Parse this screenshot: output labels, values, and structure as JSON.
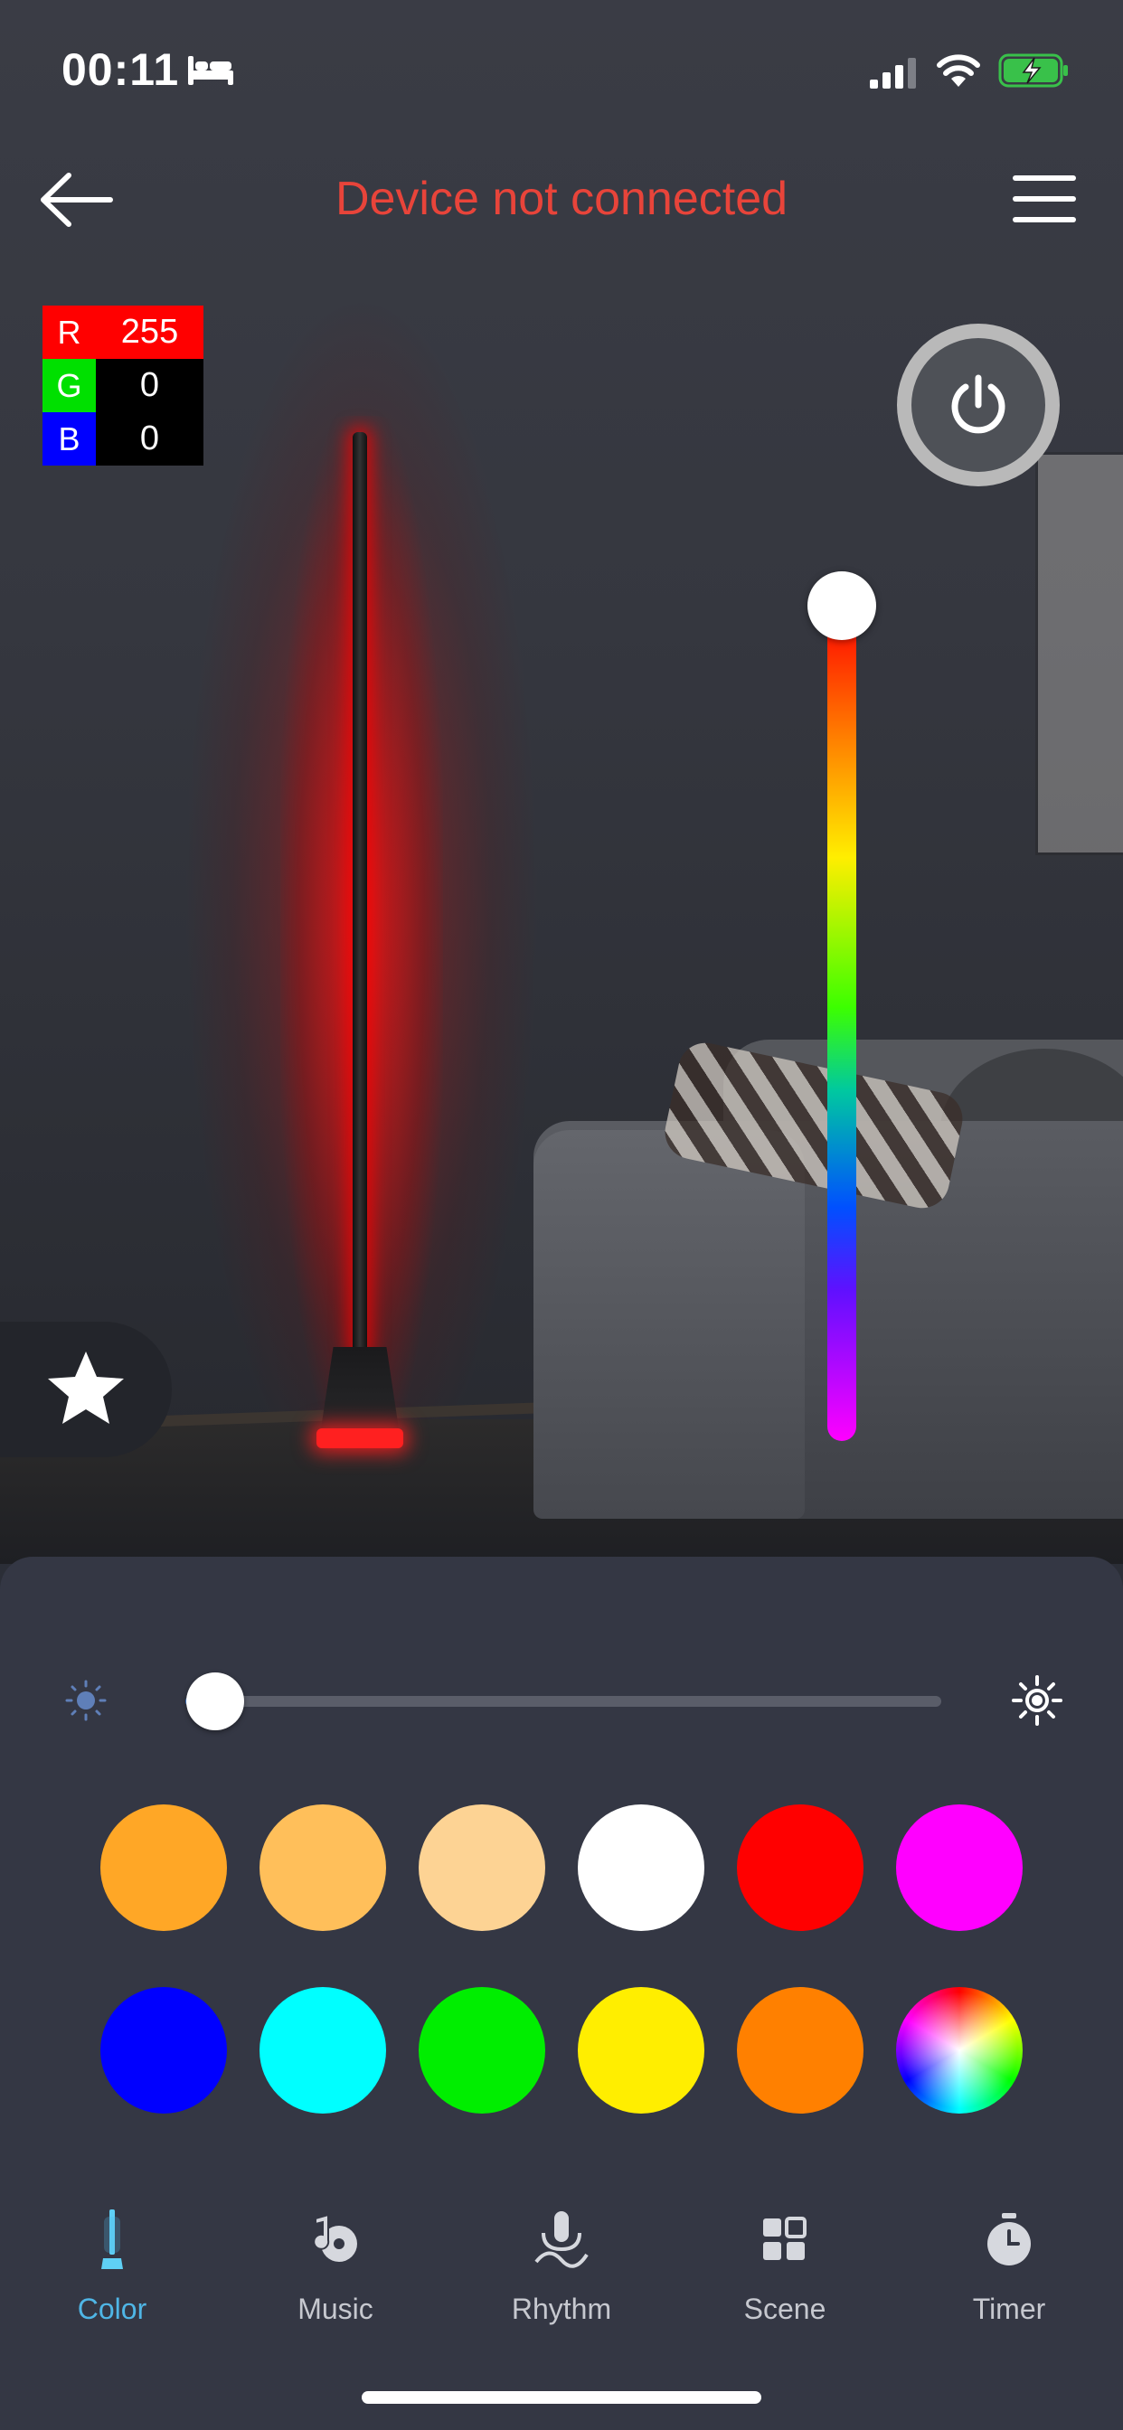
{
  "status_bar": {
    "time": "00:11"
  },
  "header": {
    "title": "Device not connected"
  },
  "rgb_readout": [
    {
      "label": "R",
      "value": "255",
      "color": "#ff0000"
    },
    {
      "label": "G",
      "value": "0",
      "color": "#00e000"
    },
    {
      "label": "B",
      "value": "0",
      "color": "#0000ff"
    }
  ],
  "current_color": "#ff0000",
  "brightness_level": 0.02,
  "hue_level": 0.0,
  "swatches": [
    {
      "color": "#ffa726",
      "name": "orange"
    },
    {
      "color": "#ffbf5a",
      "name": "light-orange"
    },
    {
      "color": "#fdd394",
      "name": "peach"
    },
    {
      "color": "#ffffff",
      "name": "white"
    },
    {
      "color": "#ff0000",
      "name": "red"
    },
    {
      "color": "#ff00ff",
      "name": "magenta"
    },
    {
      "color": "#0000ff",
      "name": "blue"
    },
    {
      "color": "#00ffff",
      "name": "cyan"
    },
    {
      "color": "#00ee00",
      "name": "green"
    },
    {
      "color": "#ffee00",
      "name": "yellow"
    },
    {
      "color": "#ff8000",
      "name": "dark-orange"
    },
    {
      "color": "conic",
      "name": "color-wheel"
    }
  ],
  "tabs": [
    {
      "label": "Color",
      "icon": "light-bar-icon",
      "active": true
    },
    {
      "label": "Music",
      "icon": "music-icon",
      "active": false
    },
    {
      "label": "Rhythm",
      "icon": "microphone-icon",
      "active": false
    },
    {
      "label": "Scene",
      "icon": "grid-icon",
      "active": false
    },
    {
      "label": "Timer",
      "icon": "stopwatch-icon",
      "active": false
    }
  ],
  "colors": {
    "title_red": "#e8443a",
    "active_tab": "#4fb6e6",
    "panel_bg": "#343744"
  }
}
